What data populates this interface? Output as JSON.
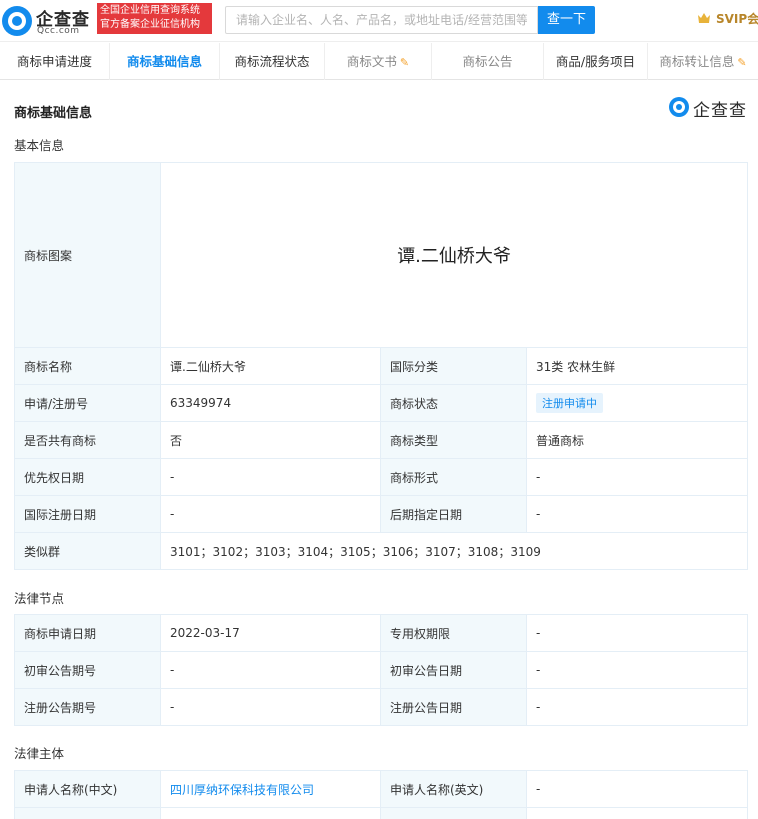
{
  "header": {
    "logo_cn": "企查查",
    "logo_en": "Qcc.com",
    "slogan_line1": "全国企业信用查询系统",
    "slogan_line2": "官方备案企业征信机构",
    "search_placeholder": "请输入企业名、人名、产品名，或地址电话/经营范围等",
    "search_button": "查一下",
    "svip_label": "SVIP会"
  },
  "tabs": [
    {
      "label": "商标申请进度"
    },
    {
      "label": "商标基础信息"
    },
    {
      "label": "商标流程状态"
    },
    {
      "label": "商标文书"
    },
    {
      "label": "商标公告"
    },
    {
      "label": "商品/服务项目"
    },
    {
      "label": "商标转让信息"
    }
  ],
  "page": {
    "title": "商标基础信息",
    "watermark": "企查查"
  },
  "basic": {
    "section_title": "基本信息",
    "image_label": "商标图案",
    "image_text": "谭.二仙桥大爷",
    "rows": [
      {
        "l1": "商标名称",
        "v1": "谭.二仙桥大爷",
        "l2": "国际分类",
        "v2": "31类 农林生鲜"
      },
      {
        "l1": "申请/注册号",
        "v1": "63349974",
        "l2": "商标状态",
        "v2": "注册申请中"
      },
      {
        "l1": "是否共有商标",
        "v1": "否",
        "l2": "商标类型",
        "v2": "普通商标"
      },
      {
        "l1": "优先权日期",
        "v1": "-",
        "l2": "商标形式",
        "v2": "-"
      },
      {
        "l1": "国际注册日期",
        "v1": "-",
        "l2": "后期指定日期",
        "v2": "-"
      }
    ],
    "similar_label": "类似群",
    "similar_value": "3101；3102；3103；3104；3105；3106；3107；3108；3109"
  },
  "legal": {
    "section_title": "法律节点",
    "rows": [
      {
        "l1": "商标申请日期",
        "v1": "2022-03-17",
        "l2": "专用权期限",
        "v2": "-"
      },
      {
        "l1": "初审公告期号",
        "v1": "-",
        "l2": "初审公告日期",
        "v2": "-"
      },
      {
        "l1": "注册公告期号",
        "v1": "-",
        "l2": "注册公告日期",
        "v2": "-"
      }
    ]
  },
  "subject": {
    "section_title": "法律主体",
    "rows": [
      {
        "l1": "申请人名称(中文)",
        "v1": "四川厚纳环保科技有限公司",
        "l2": "申请人名称(英文)",
        "v2": "-"
      }
    ]
  },
  "colors": {
    "brand_blue": "#128bed",
    "slogan_red": "#e4393c",
    "label_bg": "#f2f9fc",
    "svip_gold": "#b8862a"
  }
}
